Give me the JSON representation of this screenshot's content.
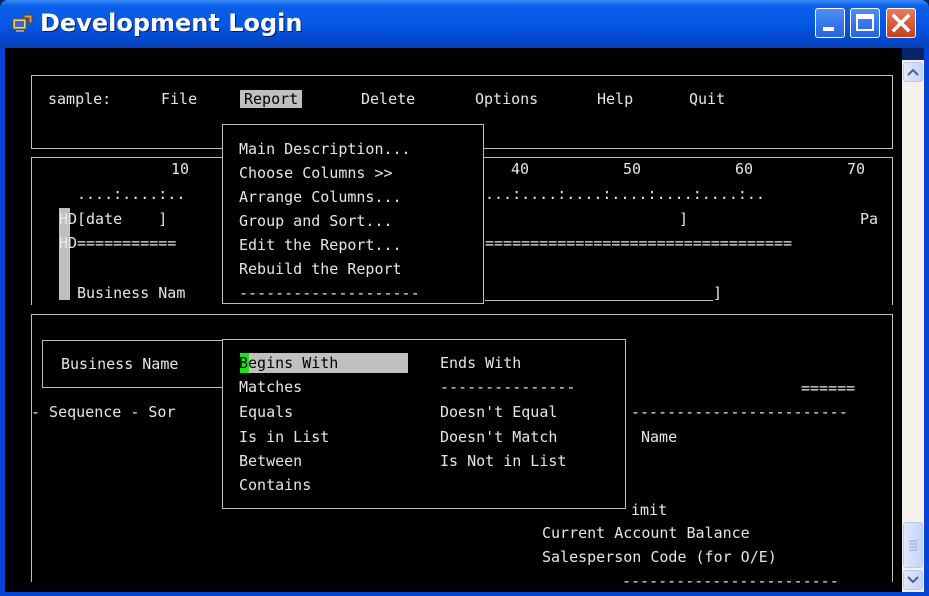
{
  "window": {
    "title": "Development Login",
    "buttons": {
      "minimize": "minimize-icon",
      "maximize": "maximize-icon",
      "close": "close-icon"
    }
  },
  "menubar": {
    "prefix": "sample:",
    "items": [
      "File",
      "Report",
      "Delete",
      "Options",
      "Help",
      "Quit"
    ],
    "active_item": "Report"
  },
  "report_menu": {
    "items": [
      "Main Description...",
      "Choose Columns >>",
      "Arrange Columns...",
      "Group and Sort...",
      "Edit the Report...",
      "Rebuild the Report"
    ],
    "separator": "--------------------"
  },
  "ruler": {
    "marks": [
      "10",
      "40",
      "50",
      "60",
      "70"
    ],
    "dots_left": "....:....:..",
    "dots_right": "...:....:....:....:....:....:.."
  },
  "layout_lines": {
    "hd_label": "HD",
    "hd1_left": "[date    ]",
    "hd1_bracket": "]",
    "hd1_right": "Pa",
    "hd2_left": "===========",
    "hd2_right": "==================================",
    "business_name": "Business Nam",
    "underline_tail": "]"
  },
  "selection_panel": {
    "field_name": "Business Name",
    "sequence_label": "- Sequence - Sor",
    "equals_right": "======",
    "dash_right": "------------------------",
    "name_label": "Name",
    "limit_label": "imit",
    "current_balance": "Current Account Balance",
    "salesperson_code": "Salesperson Code (for O/E)",
    "bottom_dash": "------------------------"
  },
  "condition_menu": {
    "left_column": [
      "Begins With",
      "Matches",
      "Equals",
      "Is in List",
      "Between",
      "Contains"
    ],
    "right_column": [
      "Ends With",
      "---------------",
      "Doesn't Equal",
      "Doesn't Match",
      "Is Not in List"
    ],
    "selected": "Begins With"
  },
  "scrollbar": {
    "up": "scroll-up-icon",
    "down": "scroll-down-icon",
    "thumb": "scroll-thumb-icon"
  },
  "colors": {
    "title_bar": "#0558e6",
    "terminal_bg": "#000000",
    "terminal_fg": "#e6e6e6",
    "highlight_bg": "#c0c0c0",
    "cursor": "#19e619",
    "close_button": "#c6401c"
  }
}
